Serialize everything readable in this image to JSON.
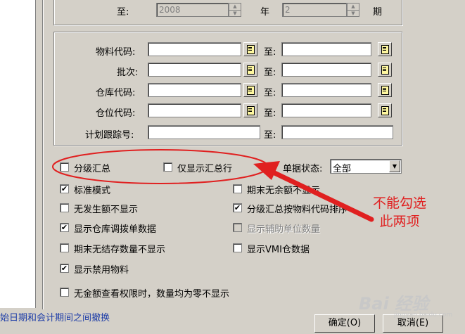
{
  "top": {
    "to_label": "至:",
    "year_value": "2008",
    "year_label": "年",
    "period_value": "2",
    "period_label": "期"
  },
  "filters": {
    "rows": [
      {
        "label": "物料代码:",
        "to": "至:"
      },
      {
        "label": "批次:",
        "to": "至:"
      },
      {
        "label": "仓库代码:",
        "to": "至:"
      },
      {
        "label": "仓位代码:",
        "to": "至:"
      },
      {
        "label": "计划跟踪号:",
        "to": "至:"
      }
    ]
  },
  "options": {
    "subtotal": {
      "label": "分级汇总",
      "checked": false
    },
    "subtotal_only": {
      "label": "仅显示汇总行",
      "checked": false
    },
    "doc_status_label": "单据状态:",
    "doc_status_value": "全部",
    "left": [
      {
        "label": "标准模式",
        "checked": true
      },
      {
        "label": "无发生额不显示",
        "checked": false
      },
      {
        "label": "显示仓库调拨单数据",
        "checked": true
      },
      {
        "label": "期末无结存数量不显示",
        "checked": false
      },
      {
        "label": "显示禁用物料",
        "checked": true
      }
    ],
    "right": [
      {
        "label": "期末无余额不显示",
        "checked": false
      },
      {
        "label": "分级汇总按物料代码排序",
        "checked": true
      },
      {
        "label": "显示辅助单位数量",
        "checked": false,
        "disabled": true
      },
      {
        "label": "显示VMI仓数据",
        "checked": false
      }
    ],
    "bottom": {
      "label": "无金额查看权限时，数量均为零不显示",
      "checked": false
    }
  },
  "buttons": {
    "ok": "确定(O)",
    "cancel": "取消(E)"
  },
  "status_text": "始日期和会计期间之间撤换",
  "annotation": "不能勾选此两项",
  "colors": {
    "annotation": "#e02020",
    "highlight_oval": "#e02020",
    "status_link": "#1f3ea8"
  },
  "watermark_text": "Bai 经验",
  "watermark_sub": "jingyan.baidu.com"
}
